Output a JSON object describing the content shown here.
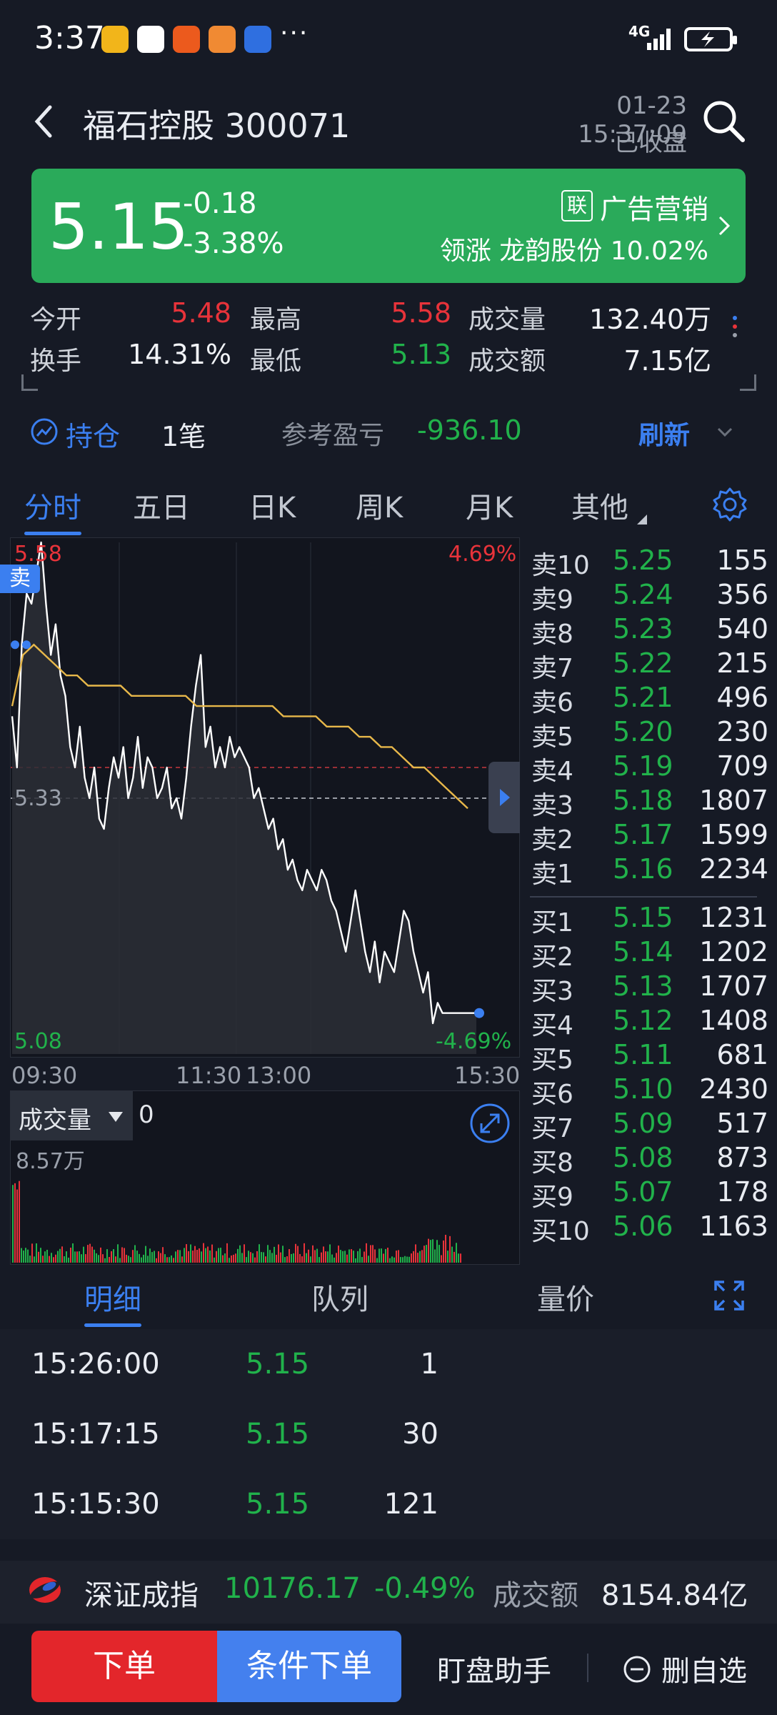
{
  "status_bar": {
    "time": "3:37",
    "more": "···",
    "network": "4G",
    "app_icons": [
      "weibo-icon",
      "multicolor-app-icon",
      "messenger-icon",
      "heart-app-icon",
      "shield-app-icon"
    ]
  },
  "header": {
    "title": "福石控股 300071",
    "datetime": "01-23 15:37:09",
    "market_status": "已收盘"
  },
  "quote": {
    "price": "5.15",
    "change": "-0.18",
    "change_pct": "-3.38%",
    "sector_badge": "联",
    "sector": "广告营销",
    "leader": "领涨 龙韵股份 10.02%",
    "colors": {
      "banner": "#2aaa5a",
      "up": "#e8333a",
      "down": "#21b24b",
      "accent": "#3b7ff0"
    }
  },
  "stats": {
    "open_label": "今开",
    "open": "5.48",
    "high_label": "最高",
    "high": "5.58",
    "volume_label": "成交量",
    "volume": "132.40万",
    "turnover_label": "换手",
    "turnover": "14.31%",
    "low_label": "最低",
    "low": "5.13",
    "amount_label": "成交额",
    "amount": "7.15亿"
  },
  "holdings": {
    "label": "持仓",
    "count": "1笔",
    "ref_label": "参考盈亏",
    "ref_value": "-936.10",
    "refresh": "刷新"
  },
  "chart_tabs": [
    "分时",
    "五日",
    "日K",
    "周K",
    "月K",
    "其他"
  ],
  "chart_data": {
    "type": "line",
    "title": "",
    "prev_close": 5.33,
    "ylim": [
      5.08,
      5.58
    ],
    "y_top_label": "5.58",
    "y_mid_label": "5.33",
    "y_bottom_label": "5.08",
    "pct_top": "4.69%",
    "pct_bottom": "-4.69%",
    "x_tick_labels": [
      "09:30",
      "11:30",
      "13:00",
      "15:30"
    ],
    "sell_marker": "卖",
    "series": [
      {
        "name": "",
        "values": [
          5.41,
          5.36,
          5.48,
          5.53,
          5.52,
          5.55,
          5.58,
          5.52,
          5.47,
          5.5,
          5.45,
          5.43,
          5.38,
          5.36,
          5.4,
          5.35,
          5.33,
          5.36,
          5.31,
          5.3,
          5.34,
          5.37,
          5.35,
          5.38,
          5.33,
          5.35,
          5.39,
          5.34,
          5.37,
          5.36,
          5.33,
          5.34,
          5.36,
          5.32,
          5.33,
          5.31,
          5.35,
          5.4,
          5.44,
          5.47,
          5.38,
          5.4,
          5.36,
          5.38,
          5.36,
          5.39,
          5.37,
          5.38,
          5.37,
          5.36,
          5.33,
          5.34,
          5.32,
          5.3,
          5.31,
          5.28,
          5.29,
          5.26,
          5.27,
          5.25,
          5.24,
          5.26,
          5.25,
          5.24,
          5.26,
          5.25,
          5.23,
          5.22,
          5.2,
          5.18,
          5.21,
          5.24,
          5.21,
          5.18,
          5.16,
          5.19,
          5.15,
          5.18,
          5.17,
          5.16,
          5.19,
          5.22,
          5.21,
          5.18,
          5.16,
          5.14,
          5.16,
          5.11,
          5.13,
          5.12,
          5.12,
          5.12,
          5.12,
          5.12,
          5.12,
          5.12,
          5.12
        ]
      },
      {
        "name": "",
        "values": [
          5.42,
          5.47,
          5.48,
          5.47,
          5.46,
          5.45,
          5.45,
          5.44,
          5.44,
          5.44,
          5.44,
          5.43,
          5.43,
          5.43,
          5.43,
          5.43,
          5.43,
          5.42,
          5.42,
          5.42,
          5.42,
          5.42,
          5.42,
          5.42,
          5.42,
          5.41,
          5.41,
          5.41,
          5.41,
          5.4,
          5.4,
          5.4,
          5.39,
          5.39,
          5.38,
          5.38,
          5.37,
          5.36,
          5.36,
          5.35,
          5.34,
          5.33,
          5.32
        ]
      }
    ],
    "volume": {
      "label": "成交量",
      "current": "0",
      "max_label": "8.57万",
      "max": 85700
    }
  },
  "order_book": {
    "asks": [
      {
        "label": "卖10",
        "price": "5.25",
        "vol": "155"
      },
      {
        "label": "卖9",
        "price": "5.24",
        "vol": "356"
      },
      {
        "label": "卖8",
        "price": "5.23",
        "vol": "540"
      },
      {
        "label": "卖7",
        "price": "5.22",
        "vol": "215"
      },
      {
        "label": "卖6",
        "price": "5.21",
        "vol": "496"
      },
      {
        "label": "卖5",
        "price": "5.20",
        "vol": "230"
      },
      {
        "label": "卖4",
        "price": "5.19",
        "vol": "709"
      },
      {
        "label": "卖3",
        "price": "5.18",
        "vol": "1807"
      },
      {
        "label": "卖2",
        "price": "5.17",
        "vol": "1599"
      },
      {
        "label": "卖1",
        "price": "5.16",
        "vol": "2234"
      }
    ],
    "bids": [
      {
        "label": "买1",
        "price": "5.15",
        "vol": "1231"
      },
      {
        "label": "买2",
        "price": "5.14",
        "vol": "1202"
      },
      {
        "label": "买3",
        "price": "5.13",
        "vol": "1707"
      },
      {
        "label": "买4",
        "price": "5.12",
        "vol": "1408"
      },
      {
        "label": "买5",
        "price": "5.11",
        "vol": "681"
      },
      {
        "label": "买6",
        "price": "5.10",
        "vol": "2430"
      },
      {
        "label": "买7",
        "price": "5.09",
        "vol": "517"
      },
      {
        "label": "买8",
        "price": "5.08",
        "vol": "873"
      },
      {
        "label": "买9",
        "price": "5.07",
        "vol": "178"
      },
      {
        "label": "买10",
        "price": "5.06",
        "vol": "1163"
      }
    ]
  },
  "detail_tabs": [
    "明细",
    "队列",
    "量价"
  ],
  "details": [
    {
      "time": "15:26:00",
      "price": "5.15",
      "vol": "1"
    },
    {
      "time": "15:17:15",
      "price": "5.15",
      "vol": "30"
    },
    {
      "time": "15:15:30",
      "price": "5.15",
      "vol": "121"
    }
  ],
  "index": {
    "name": "深证成指",
    "value": "10176.17",
    "pct": "-0.49%",
    "amount_label": "成交额",
    "amount": "8154.84亿"
  },
  "actions": {
    "order": "下单",
    "conditional": "条件下单",
    "watch": "盯盘助手",
    "remove": "删自选"
  }
}
